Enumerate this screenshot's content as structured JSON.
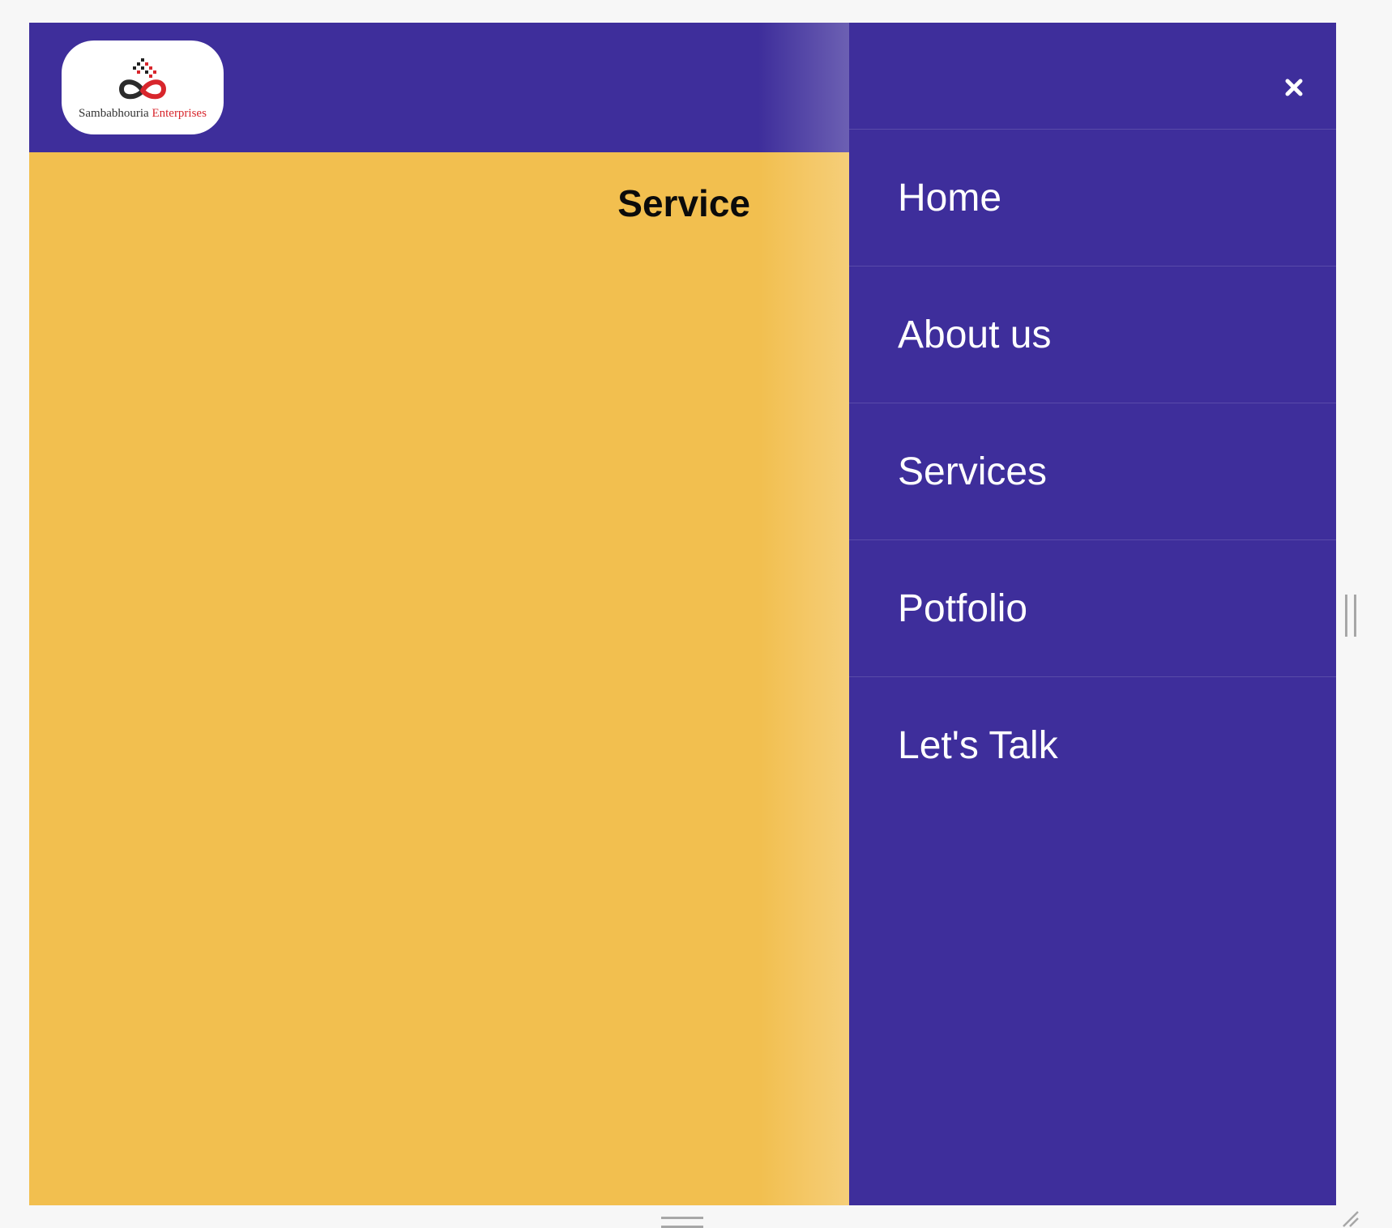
{
  "logo": {
    "name_part1": "Sambabhouria",
    "name_part2": "Enterprises",
    "icon": "infinity-logo-icon",
    "accent_color": "#d8262c"
  },
  "page": {
    "title": "Service"
  },
  "drawer": {
    "close_icon": "close-icon",
    "items": [
      {
        "label": "Home"
      },
      {
        "label": "About us"
      },
      {
        "label": "Services"
      },
      {
        "label": "Potfolio"
      },
      {
        "label": "Let's Talk"
      }
    ]
  },
  "colors": {
    "primary": "#3e2e9b",
    "background": "#f2bf4f",
    "text_light": "#ffffff",
    "text_dark": "#0b0b0b"
  }
}
